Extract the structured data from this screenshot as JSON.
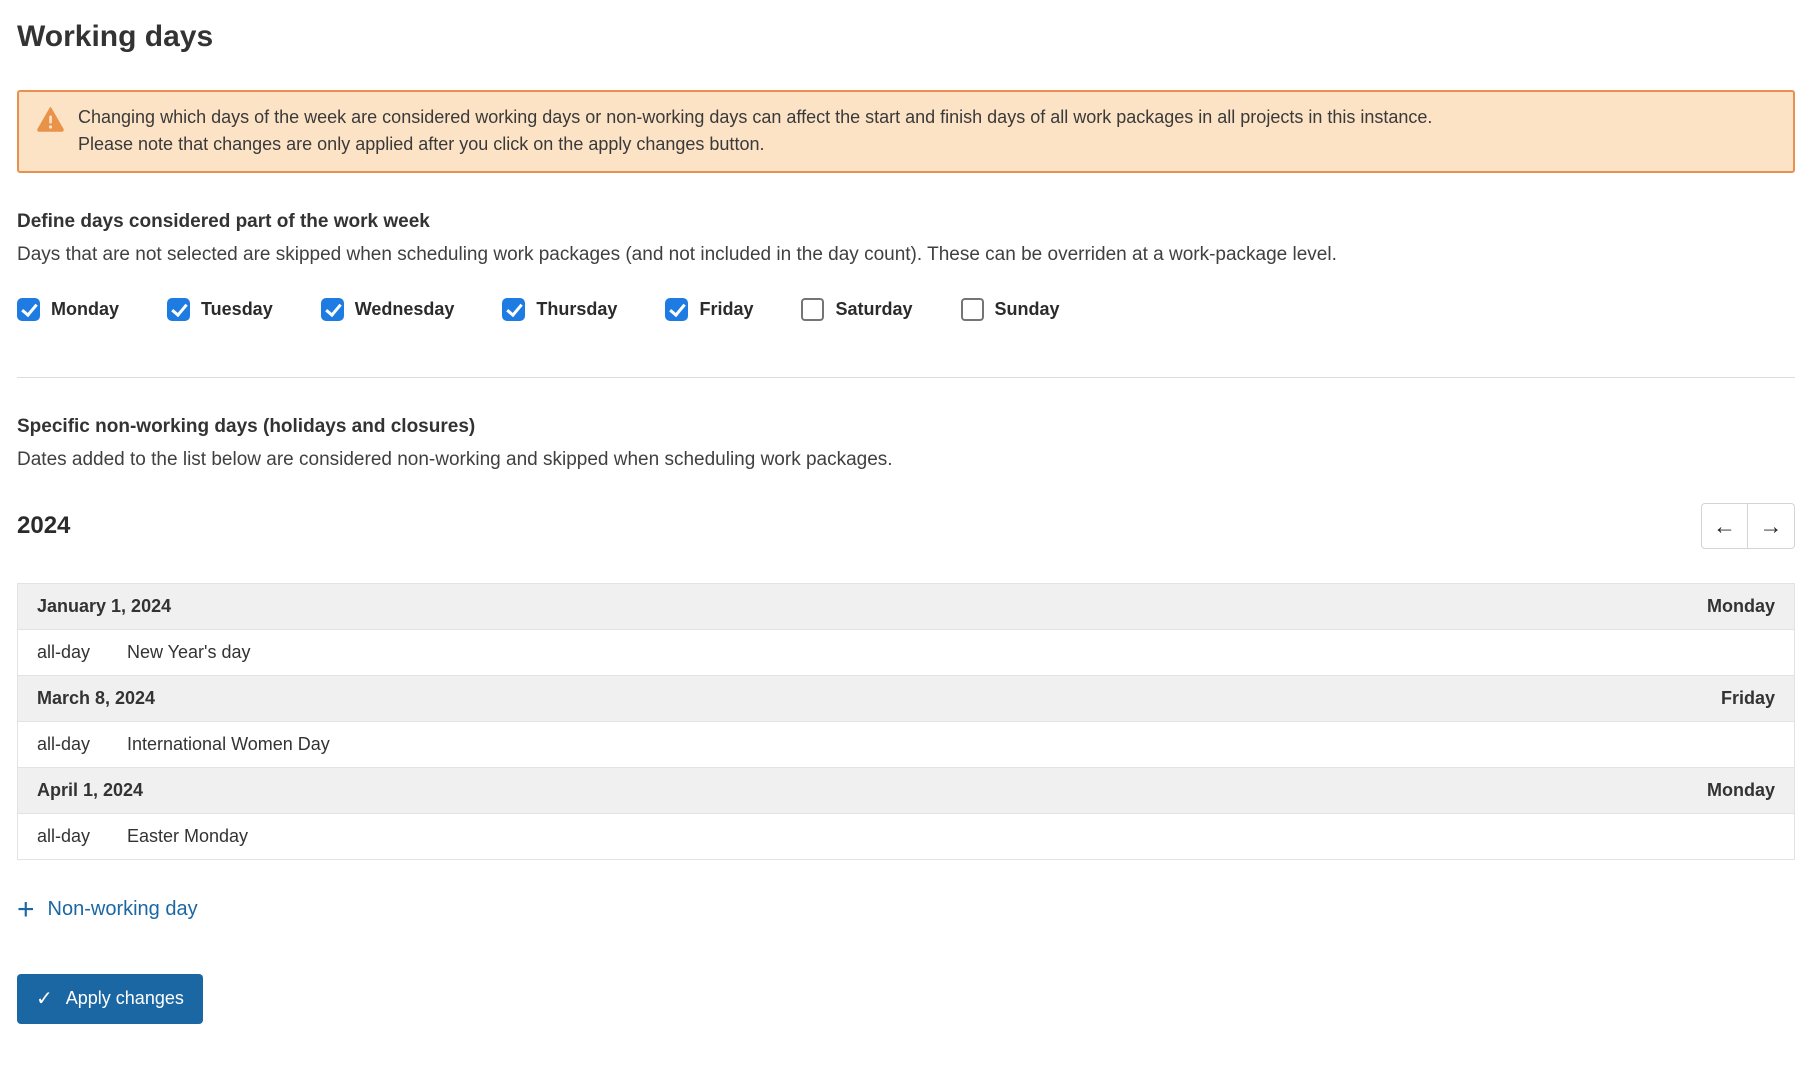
{
  "page": {
    "title": "Working days"
  },
  "warning": {
    "line1": "Changing which days of the week are considered working days or non-working days can affect the start and finish days of all work packages in all projects in this instance.",
    "line2": "Please note that changes are only applied after you click on the apply changes button."
  },
  "work_week": {
    "heading": "Define days considered part of the work week",
    "description": "Days that are not selected are skipped when scheduling work packages (and not included in the day count). These can be overriden at a work-package level.",
    "days": [
      {
        "label": "Monday",
        "checked": true
      },
      {
        "label": "Tuesday",
        "checked": true
      },
      {
        "label": "Wednesday",
        "checked": true
      },
      {
        "label": "Thursday",
        "checked": true
      },
      {
        "label": "Friday",
        "checked": true
      },
      {
        "label": "Saturday",
        "checked": false
      },
      {
        "label": "Sunday",
        "checked": false
      }
    ]
  },
  "non_working": {
    "heading": "Specific non-working days (holidays and closures)",
    "description": "Dates added to the list below are considered non-working and skipped when scheduling work packages.",
    "year": "2024",
    "entries": [
      {
        "date": "January 1, 2024",
        "weekday": "Monday",
        "time": "all-day",
        "name": "New Year's day"
      },
      {
        "date": "March 8, 2024",
        "weekday": "Friday",
        "time": "all-day",
        "name": "International Women Day"
      },
      {
        "date": "April 1, 2024",
        "weekday": "Monday",
        "time": "all-day",
        "name": "Easter Monday"
      }
    ],
    "add_label": "Non-working day"
  },
  "actions": {
    "apply_label": "Apply changes"
  },
  "icons": {
    "left_arrow": "←",
    "right_arrow": "→",
    "plus": "+",
    "check": "✓"
  },
  "colors": {
    "checkbox_blue": "#1E7BE2",
    "primary_blue": "#1A67A3",
    "banner_bg": "#FCE3C5",
    "banner_border": "#E79150",
    "table_header_bg": "#F0F0F0",
    "table_border": "#E3E3E3"
  }
}
